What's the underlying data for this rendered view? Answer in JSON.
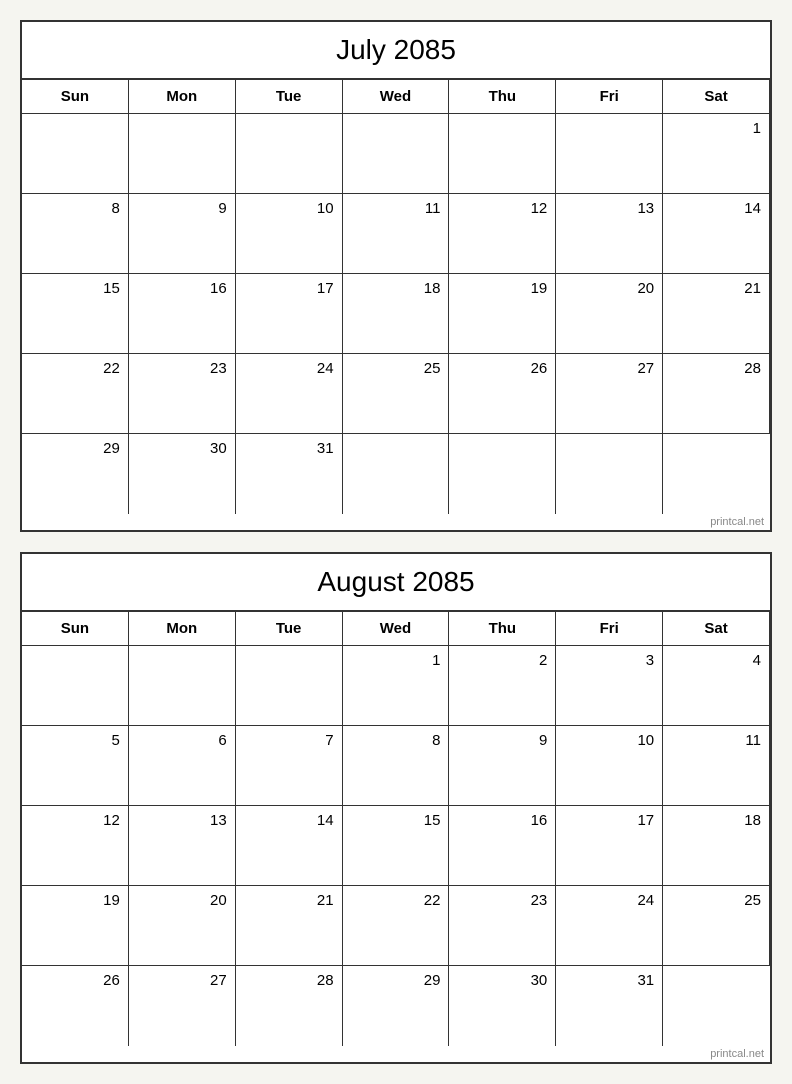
{
  "july": {
    "title": "July 2085",
    "headers": [
      "Sun",
      "Mon",
      "Tue",
      "Wed",
      "Thu",
      "Fri",
      "Sat"
    ],
    "weeks": [
      [
        "",
        "",
        "",
        "",
        "",
        "",
        ""
      ],
      [
        "",
        "",
        "",
        "",
        "",
        "",
        ""
      ],
      [
        "",
        "",
        "",
        "",
        "",
        "",
        ""
      ],
      [
        "",
        "",
        "",
        "",
        "",
        "",
        ""
      ],
      [
        "",
        "",
        "",
        "",
        "",
        "",
        ""
      ]
    ],
    "days": {
      "w0": [
        "",
        "",
        "",
        "",
        "",
        "",
        "1"
      ],
      "w1": [
        "8",
        "9",
        "10",
        "11",
        "12",
        "13",
        "14"
      ],
      "w2": [
        "15",
        "16",
        "17",
        "18",
        "19",
        "20",
        "21"
      ],
      "w3": [
        "22",
        "23",
        "24",
        "25",
        "26",
        "27",
        "28"
      ],
      "w4": [
        "29",
        "30",
        "31",
        "",
        "",
        "",
        ""
      ]
    }
  },
  "august": {
    "title": "August 2085",
    "headers": [
      "Sun",
      "Mon",
      "Tue",
      "Wed",
      "Thu",
      "Fri",
      "Sat"
    ],
    "days": {
      "w0": [
        "",
        "",
        "",
        "1",
        "2",
        "3",
        "4"
      ],
      "w1": [
        "5",
        "6",
        "7",
        "8",
        "9",
        "10",
        "11"
      ],
      "w2": [
        "12",
        "13",
        "14",
        "15",
        "16",
        "17",
        "18"
      ],
      "w3": [
        "19",
        "20",
        "21",
        "22",
        "23",
        "24",
        "25"
      ],
      "w4": [
        "26",
        "27",
        "28",
        "29",
        "30",
        "31",
        ""
      ]
    }
  },
  "watermark": "printcal.net"
}
